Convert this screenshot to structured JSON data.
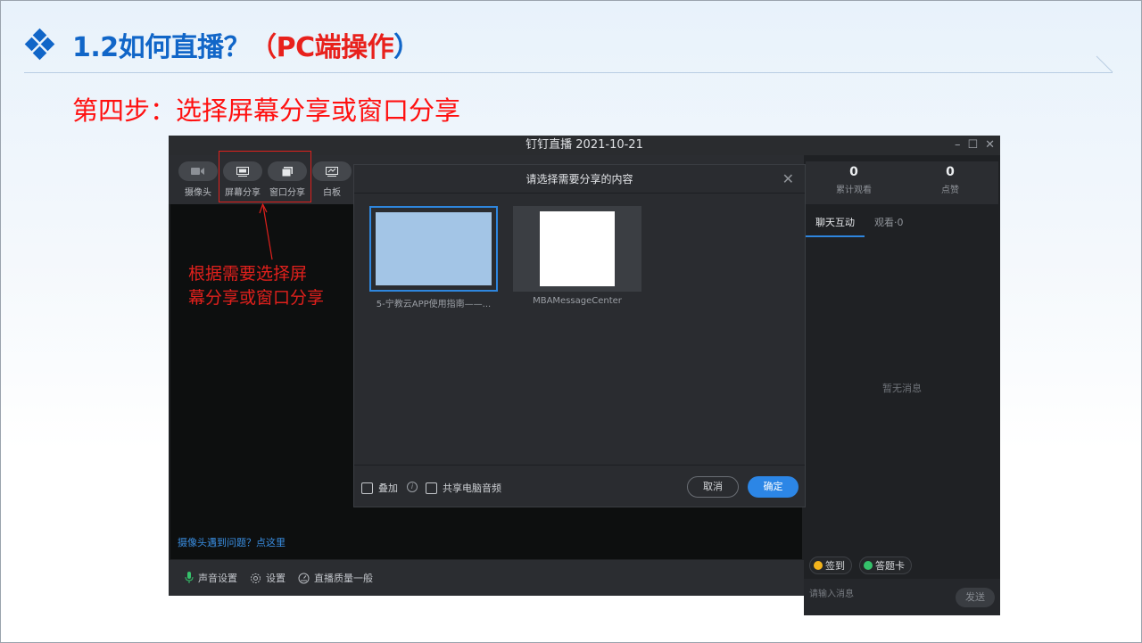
{
  "slide": {
    "title_prefix": "1.2如何直播？",
    "title_paren_open": "（",
    "title_highlight": "PC端操作",
    "title_paren_close": "）",
    "step_heading": "第四步：选择屏幕分享或窗口分享",
    "annotation_line1": "根据需要选择屏",
    "annotation_line2": "幕分享或窗口分享",
    "colors": {
      "title_blue": "#1166c8",
      "accent_red": "#e8211c"
    }
  },
  "app": {
    "window_title": "钉钉直播 2021-10-21",
    "window_controls": {
      "minimize": "–",
      "maximize": "☐",
      "close": "✕"
    },
    "toolbar": {
      "camera_label": "摄像头",
      "screen_share_label": "屏幕分享",
      "window_share_label": "窗口分享",
      "whiteboard_label": "白板"
    },
    "camera_help_link": "摄像头遇到问题？点这里",
    "bottom_bar": {
      "audio_settings": "声音设置",
      "settings": "设置",
      "stream_quality": "直播质量一般"
    },
    "stats": {
      "views_count": "0",
      "views_label": "累计观看",
      "likes_count": "0",
      "likes_label": "点赞"
    },
    "right_tabs": {
      "chat": "聊天互动",
      "viewers": "观看·0"
    },
    "no_messages": "暂无消息",
    "actions": {
      "checkin": "签到",
      "answer_card": "答题卡"
    },
    "message_placeholder": "请输入消息",
    "send_button": "发送",
    "accent": "#2e86de"
  },
  "dialog": {
    "title": "请选择需要分享的内容",
    "close": "✕",
    "items": [
      {
        "caption": "5-宁教云APP使用指南——...",
        "selected": true
      },
      {
        "caption": "MBAMessageCenter",
        "selected": false
      }
    ],
    "overlay_label": "叠加",
    "share_audio_label": "共享电脑音频",
    "cancel_button": "取消",
    "ok_button": "确定"
  }
}
